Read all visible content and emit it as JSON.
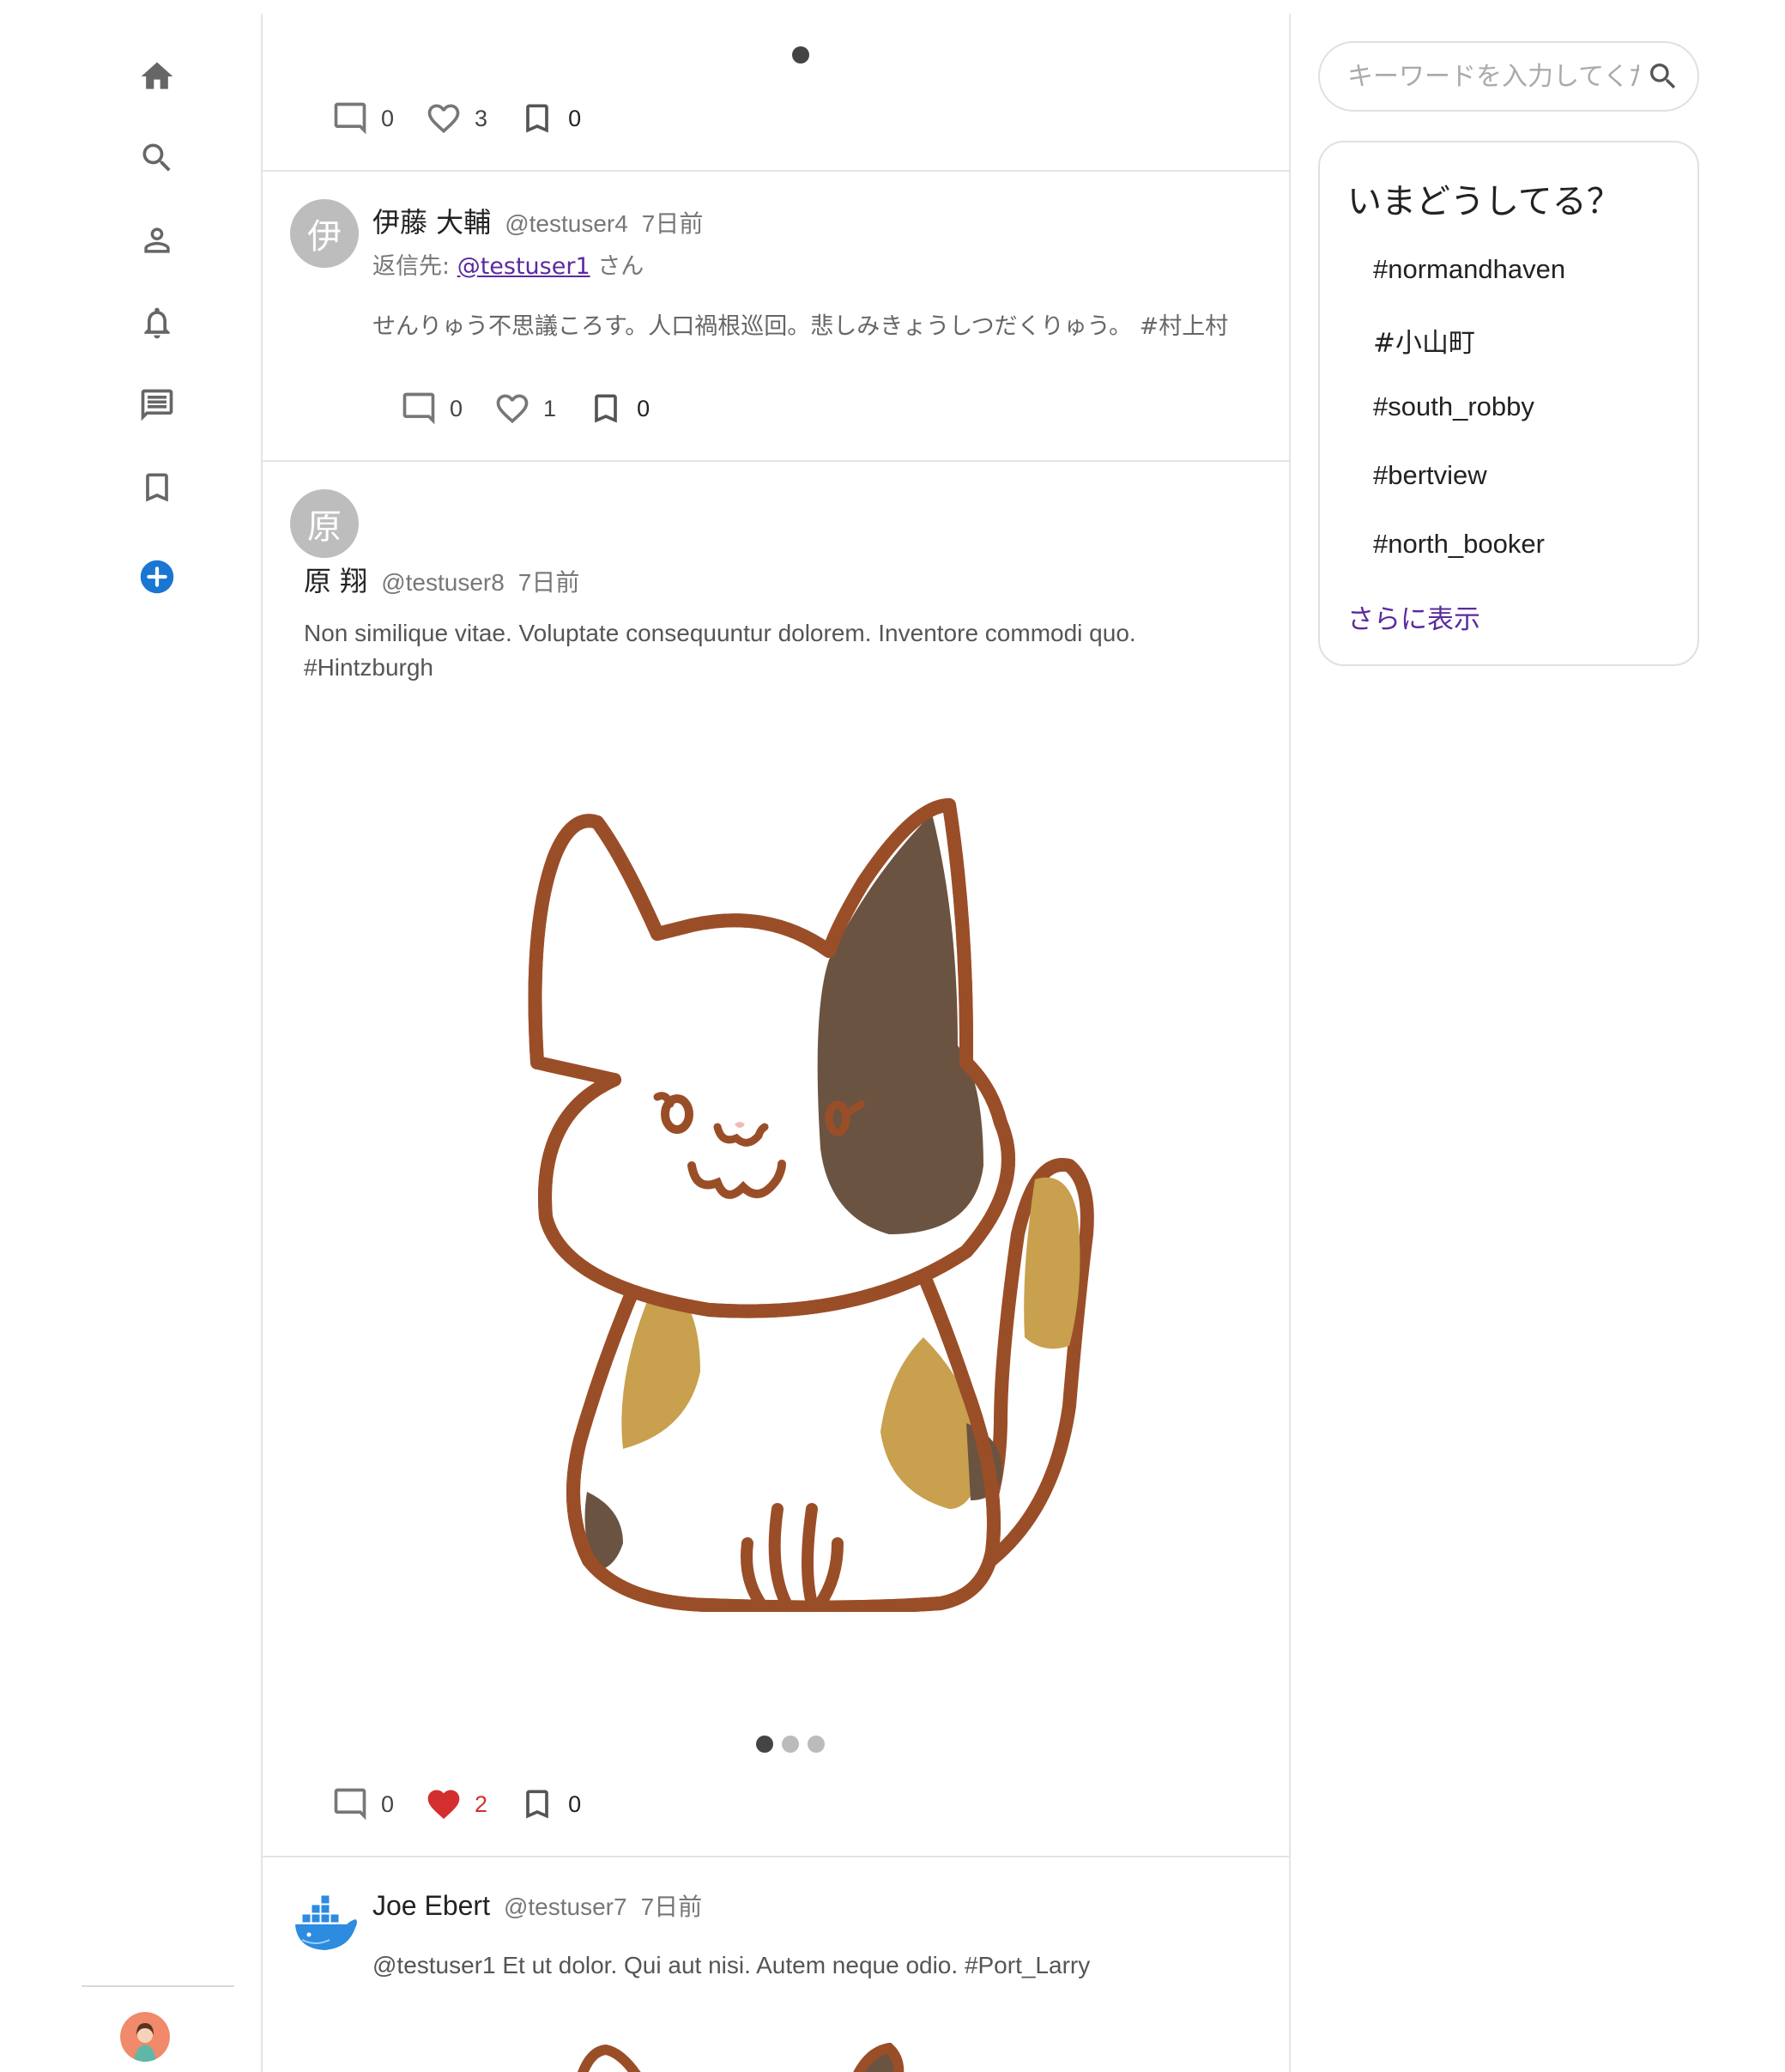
{
  "nav": {
    "items": [
      "home-icon",
      "search-icon",
      "profile-icon",
      "notifications-icon",
      "messages-icon",
      "bookmarks-icon",
      "compose-icon"
    ]
  },
  "posts": [
    {
      "comments": "0",
      "likes": "3",
      "bookmarks": "0"
    },
    {
      "avatar_letter": "伊",
      "name": "伊藤 大輔",
      "handle": "@testuser4",
      "time": "7日前",
      "reply_prefix": "返信先:",
      "reply_to": "@testuser1",
      "reply_suffix": "さん",
      "body": "せんりゅう不思議ころす。人口禍根巡回。悲しみきょうしつだくりゅう。 #村上村",
      "comments": "0",
      "likes": "1",
      "bookmarks": "0"
    },
    {
      "avatar_letter": "原",
      "name": "原 翔",
      "handle": "@testuser8",
      "time": "7日前",
      "body_line1": "Non similique vitae. Voluptate consequuntur dolorem. Inventore commodi quo.",
      "body_line2": "#Hintzburgh",
      "comments": "0",
      "likes": "2",
      "bookmarks": "0"
    },
    {
      "name": "Joe Ebert",
      "handle": "@testuser7",
      "time": "7日前",
      "body": "@testuser1 Et ut dolor. Qui aut nisi. Autem neque odio. #Port_Larry"
    }
  ],
  "search": {
    "placeholder": "キーワードを入力してください"
  },
  "trends": {
    "title": "いまどうしてる？",
    "items": [
      "#normandhaven",
      "#小山町",
      "#south_robby",
      "#bertview",
      "#north_booker"
    ],
    "more": "さらに表示"
  },
  "colors": {
    "accent_link": "#5b2a9e",
    "liked": "#d32f2f",
    "compose_blue": "#1976d2",
    "border": "#e4e4e4"
  }
}
